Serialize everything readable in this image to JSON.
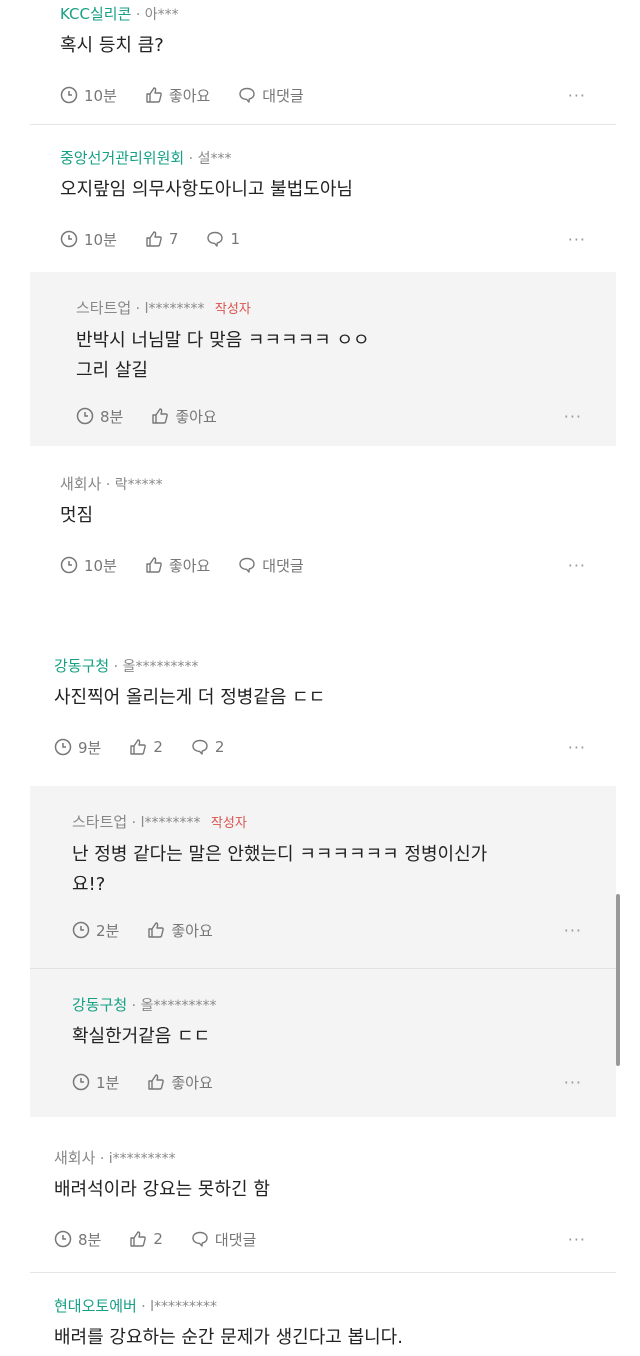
{
  "comments": [
    {
      "author": "KCC실리콘",
      "handle": "아***",
      "text": "혹시 등치 큼?",
      "time": "10분",
      "like": "좋아요",
      "reply": "대댓글"
    },
    {
      "author": "중앙선거관리위원회",
      "handle": "설***",
      "text": "오지랖임 의무사항도아니고 불법도아님",
      "time": "10분",
      "like": "7",
      "reply": "1"
    },
    {
      "author": "스타트업",
      "handle": "l********",
      "badge": "작성자",
      "text": "반박시 너님말 다 맞음 ㅋㅋㅋㅋㅋ ㅇㅇ",
      "text2": "그리 살길",
      "time": "8분",
      "like": "좋아요"
    },
    {
      "author": "새회사",
      "handle": "락*****",
      "text": "멋짐",
      "time": "10분",
      "like": "좋아요",
      "reply": "대댓글"
    },
    {
      "author": "강동구청",
      "handle": "올*********",
      "text": "사진찍어 올리는게 더 정병같음 ㄷㄷ",
      "time": "9분",
      "like": "2",
      "reply": "2"
    },
    {
      "author": "스타트업",
      "handle": "l********",
      "badge": "작성자",
      "text": "난 정병 같다는 말은 안했는디 ㅋㅋㅋㅋㅋㅋ 정병이신가",
      "text2": "요!?",
      "time": "2분",
      "like": "좋아요"
    },
    {
      "author": "강동구청",
      "handle": "올*********",
      "text": "확실한거같음 ㄷㄷ",
      "time": "1분",
      "like": "좋아요"
    },
    {
      "author": "새회사",
      "handle": "i*********",
      "text": "배려석이라 강요는 못하긴 함",
      "time": "8분",
      "like": "2",
      "reply": "대댓글"
    },
    {
      "author": "현대오토에버",
      "handle": "l*********",
      "text": "배려를 강요하는 순간 문제가 생긴다고 봅니다."
    }
  ],
  "more_label": "···",
  "dot_sep": "·",
  "colors": {
    "company": "#16a085",
    "badge": "#d9534f",
    "reply_bg": "#f4f4f4"
  }
}
